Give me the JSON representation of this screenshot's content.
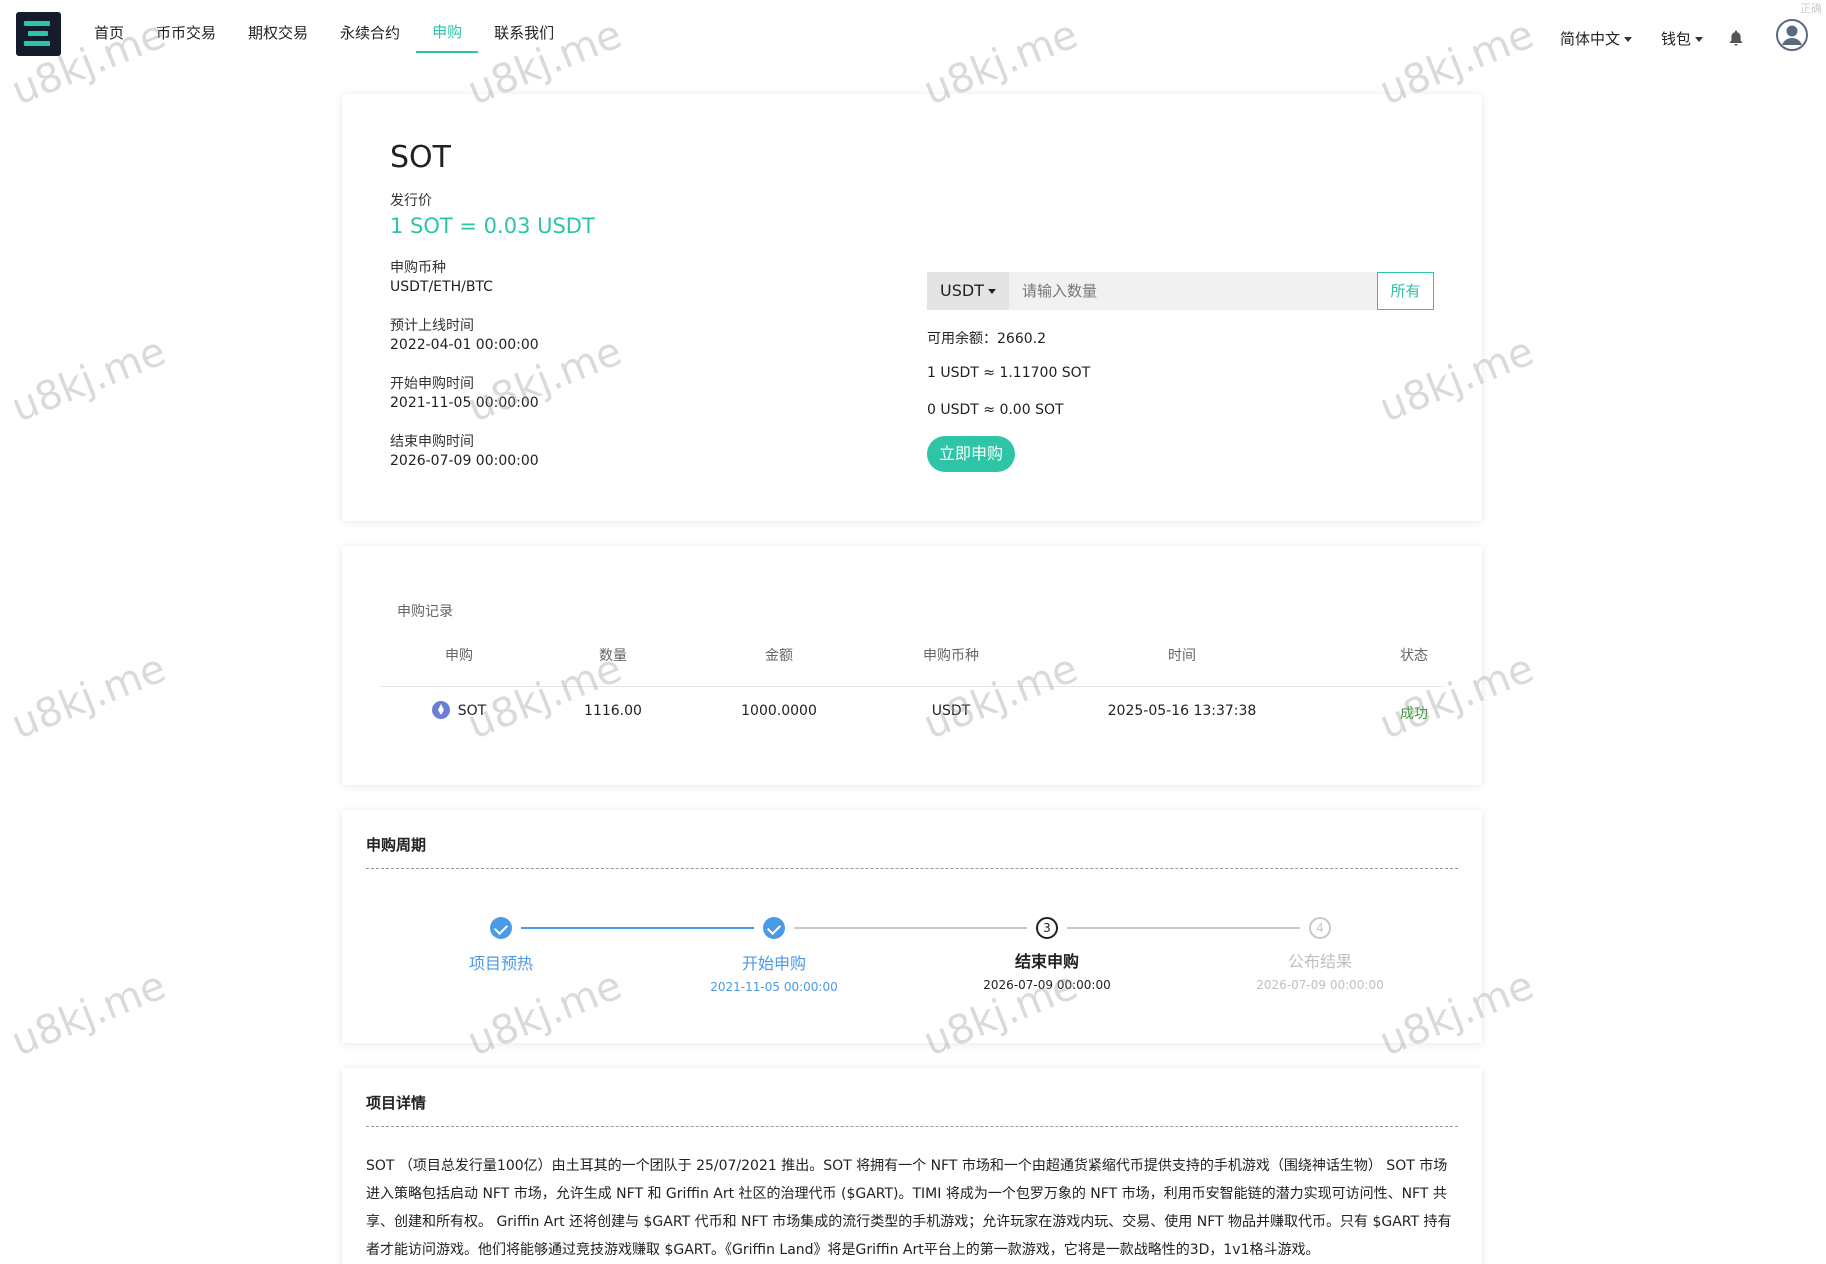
{
  "header": {
    "nav": [
      "首页",
      "币币交易",
      "期权交易",
      "永续合约",
      "申购",
      "联系我们"
    ],
    "active_nav": "申购",
    "language": "简体中文",
    "wallet": "钱包",
    "corner_text": "正确"
  },
  "watermark": "u8kj.me",
  "project": {
    "name": "SOT",
    "issue_price_label": "发行价",
    "issue_price": "1 SOT = 0.03 USDT",
    "currency_label": "申购币种",
    "currency": "USDT/ETH/BTC",
    "listing_label": "预计上线时间",
    "listing_time": "2022-04-01 00:00:00",
    "start_label": "开始申购时间",
    "start_time": "2021-11-05 00:00:00",
    "end_label": "结束申购时间",
    "end_time": "2026-07-09 00:00:00"
  },
  "subscribe": {
    "currency": "USDT",
    "amount_placeholder": "请输入数量",
    "all_button": "所有",
    "balance": "可用余额：2660.2",
    "rate": "1 USDT ≈ 1.11700 SOT",
    "estimate": "0 USDT ≈ 0.00 SOT",
    "submit_button": "立即申购"
  },
  "records": {
    "title": "申购记录",
    "columns": [
      "申购",
      "数量",
      "金额",
      "申购币种",
      "时间",
      "状态"
    ],
    "rows": [
      {
        "coin": "SOT",
        "quantity": "1116.00",
        "amount": "1000.0000",
        "currency": "USDT",
        "time": "2025-05-16 13:37:38",
        "status": "成功"
      }
    ]
  },
  "cycle": {
    "title": "申购周期",
    "steps": [
      {
        "name": "项目预热",
        "date": "",
        "state": "done"
      },
      {
        "name": "开始申购",
        "date": "2021-11-05 00:00:00",
        "state": "done"
      },
      {
        "name": "结束申购",
        "date": "2026-07-09 00:00:00",
        "state": "current",
        "index": "3"
      },
      {
        "name": "公布结果",
        "date": "2026-07-09 00:00:00",
        "state": "wait",
        "index": "4"
      }
    ]
  },
  "details": {
    "title": "项目详情",
    "text": "SOT （项目总发行量100亿）由土耳其的一个团队于 25/07/2021 推出。SOT 将拥有一个 NFT 市场和一个由超通货紧缩代币提供支持的手机游戏（围绕神话生物） SOT 市场进入策略包括启动 NFT 市场，允许生成 NFT 和 Griffin Art 社区的治理代币 ($GART)。TIMI 将成为一个包罗万象的 NFT 市场，利用币安智能链的潜力实现可访问性、NFT 共享、创建和所有权。 Griffin Art 还将创建与 $GART 代币和 NFT 市场集成的流行类型的手机游戏；允许玩家在游戏内玩、交易、使用 NFT 物品并赚取代币。只有 $GART 持有者才能访问游戏。他们将能够通过竞技游戏赚取 $GART。《Griffin Land》将是Griffin Art平台上的第一款游戏，它将是一款战略性的3D，1v1格斗游戏。"
  },
  "colors": {
    "accent": "#2ec4a6",
    "step_done": "#4a9ae5",
    "success": "#3a9a3a"
  }
}
